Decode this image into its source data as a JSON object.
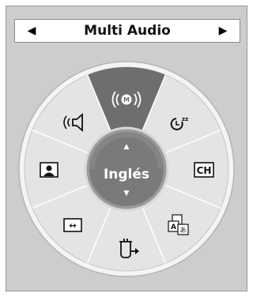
{
  "header": {
    "title": "Multi Audio",
    "prev_glyph": "◀",
    "next_glyph": "▶"
  },
  "wheel": {
    "center_label": "Inglés",
    "center_up_glyph": "▲",
    "center_down_glyph": "▼",
    "sectors": [
      {
        "name": "multi-audio",
        "icon": "multi-audio-icon",
        "selected": true
      },
      {
        "name": "sleep-timer",
        "icon": "sleep-timer-icon",
        "text": "zz"
      },
      {
        "name": "channel-list",
        "icon": "channel-icon",
        "text": "CH"
      },
      {
        "name": "subtitle-language",
        "icon": "subtitle-language-icon",
        "text": "A",
        "text2": "あ"
      },
      {
        "name": "input",
        "icon": "input-icon"
      },
      {
        "name": "aspect-ratio",
        "icon": "aspect-ratio-icon",
        "text": "↔"
      },
      {
        "name": "picture-mode",
        "icon": "picture-mode-icon"
      },
      {
        "name": "sound-mode",
        "icon": "sound-mode-icon"
      }
    ]
  },
  "colors": {
    "panel": "#cdcdcd",
    "wheel_fill": "#e4e4e4",
    "wheel_rim": "#f4f4f4",
    "selected_sector": "#6e6e6e",
    "center_fill": "#7a7a7a",
    "center_text": "#ffffff"
  }
}
